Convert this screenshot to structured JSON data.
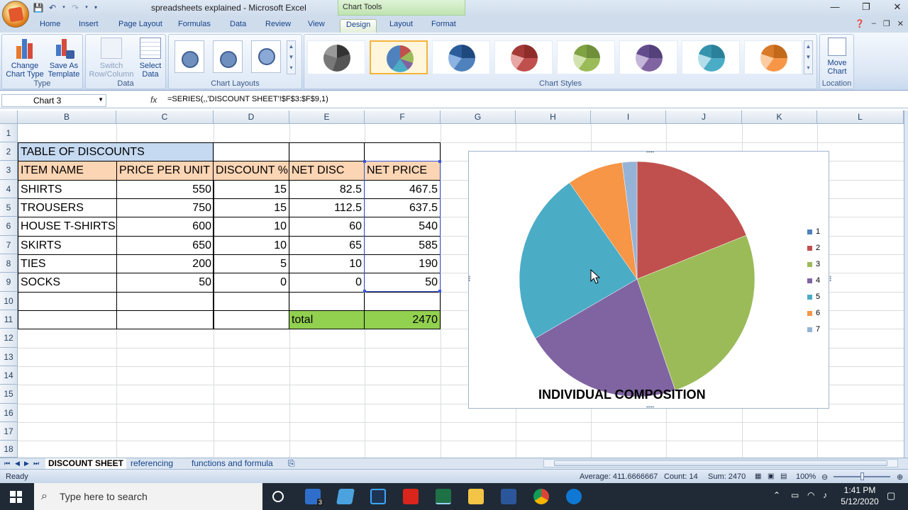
{
  "window": {
    "title": "spreadsheets explained - Microsoft Excel",
    "context_tab_group": "Chart Tools",
    "controls": [
      "—",
      "❐",
      "✕"
    ]
  },
  "tabs": [
    "Home",
    "Insert",
    "Page Layout",
    "Formulas",
    "Data",
    "Review",
    "View",
    "Design",
    "Layout",
    "Format"
  ],
  "active_tab": "Design",
  "ribbon": {
    "type_group": {
      "label": "Type",
      "change_chart_type": "Change Chart Type",
      "save_as_template": "Save As Template"
    },
    "data_group": {
      "label": "Data",
      "switch_row_column": "Switch Row/Column",
      "select_data": "Select Data"
    },
    "layouts_group": {
      "label": "Chart Layouts"
    },
    "styles_group": {
      "label": "Chart Styles"
    },
    "location_group": {
      "label": "Location",
      "move_chart": "Move Chart"
    }
  },
  "formula_bar": {
    "name_box": "Chart 3",
    "fx": "fx",
    "formula": "=SERIES(,,'DISCOUNT SHEET'!$F$3:$F$9,1)"
  },
  "columns": [
    "B",
    "C",
    "D",
    "E",
    "F",
    "G",
    "H",
    "I",
    "J",
    "K",
    "L"
  ],
  "rows": [
    "1",
    "2",
    "3",
    "4",
    "5",
    "6",
    "7",
    "8",
    "9",
    "10",
    "11",
    "12",
    "13",
    "14",
    "15",
    "16",
    "17",
    "18"
  ],
  "table": {
    "title": "TABLE OF DISCOUNTS",
    "headers": [
      "ITEM NAME",
      "PRICE PER UNIT",
      "DISCOUNT %",
      "NET DISC",
      "NET PRICE"
    ],
    "rows": [
      [
        "SHIRTS",
        "550",
        "15",
        "82.5",
        "467.5"
      ],
      [
        "TROUSERS",
        "750",
        "15",
        "112.5",
        "637.5"
      ],
      [
        "HOUSE T-SHIRTS",
        "600",
        "10",
        "60",
        "540"
      ],
      [
        "SKIRTS",
        "650",
        "10",
        "65",
        "585"
      ],
      [
        "TIES",
        "200",
        "5",
        "10",
        "190"
      ],
      [
        "SOCKS",
        "50",
        "0",
        "0",
        "50"
      ]
    ],
    "total_label": "total",
    "total_value": "2470"
  },
  "chart_data": {
    "type": "pie",
    "title": "INDIVIDUAL  COMPOSITION",
    "categories": [
      "1",
      "2",
      "3",
      "4",
      "5",
      "6",
      "7"
    ],
    "values": [
      0,
      467.5,
      637.5,
      540,
      585,
      190,
      50
    ],
    "colors": [
      "#4f81bd",
      "#c0504d",
      "#9bbb59",
      "#8064a2",
      "#4bacc6",
      "#f79646",
      "#95b3d7"
    ],
    "legend_position": "right"
  },
  "sheet_tabs": [
    "DISCOUNT SHEET",
    "referencing",
    "functions and formula"
  ],
  "active_sheet": "DISCOUNT SHEET",
  "status_bar": {
    "mode": "Ready",
    "average": "Average: 411.6666667",
    "count": "Count: 14",
    "sum": "Sum: 2470",
    "zoom": "100%"
  },
  "taskbar": {
    "search_placeholder": "Type here to search",
    "time": "1:41 PM",
    "date": "5/12/2020",
    "mail_badge": "3"
  }
}
